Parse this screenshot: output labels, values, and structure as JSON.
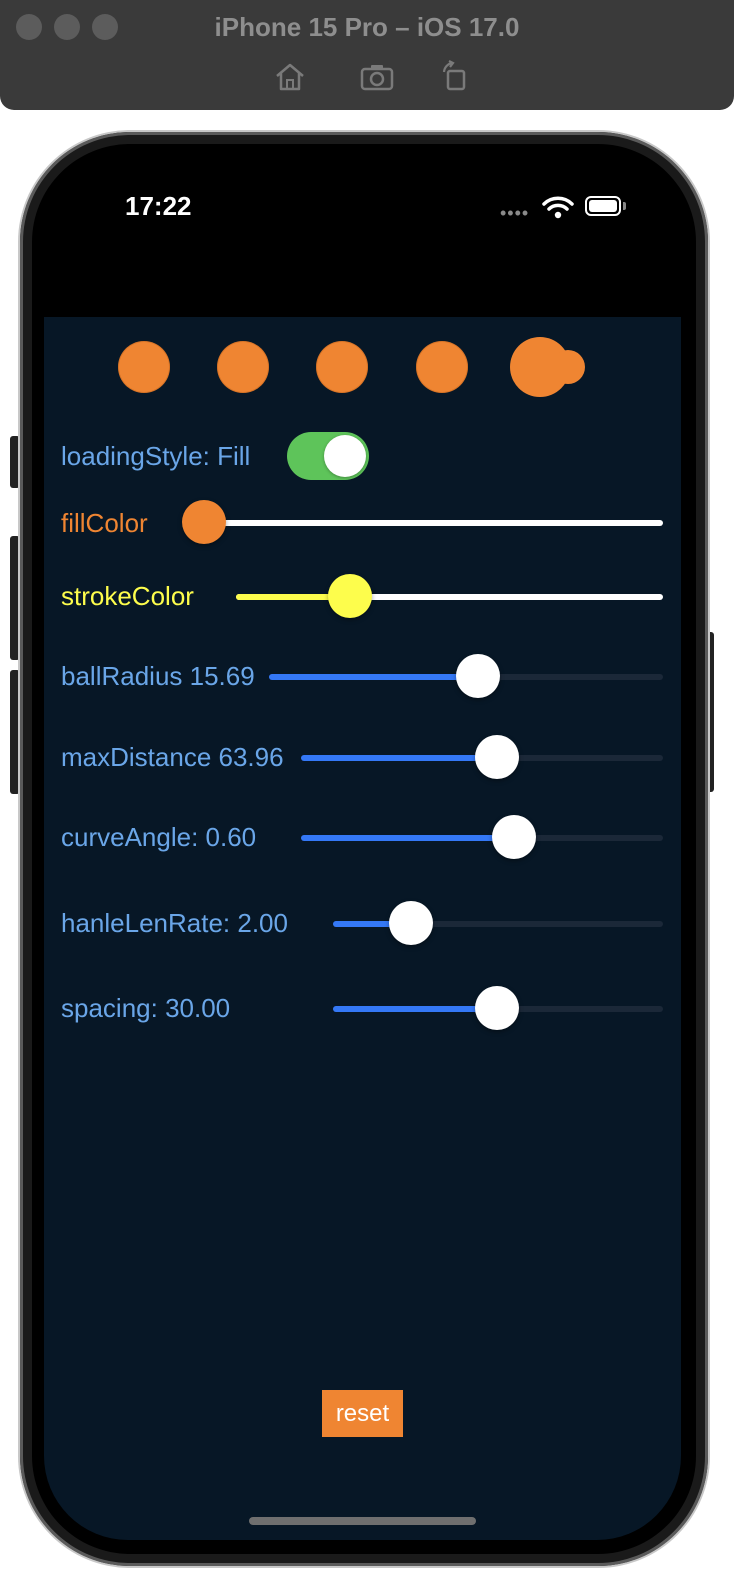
{
  "simulator": {
    "title": "iPhone 15 Pro – iOS 17.0",
    "tools": [
      "home-icon",
      "screenshot-icon",
      "rotate-icon"
    ]
  },
  "status_bar": {
    "time": "17:22",
    "signal": "••••",
    "icons": [
      "wifi-icon",
      "battery-icon"
    ]
  },
  "app": {
    "background": "#071726",
    "accent": "#ef8532",
    "balls_count": 5,
    "loading_style": {
      "label": "loadingStyle: Fill",
      "on": true
    },
    "fill_color": {
      "label": "fillColor",
      "color": "#ef8532",
      "value": 0.0
    },
    "stroke_color": {
      "label": "strokeColor",
      "color": "#fdfd4c",
      "value": 0.27
    },
    "sliders": [
      {
        "label": "ballRadius 15.69",
        "value": 0.53
      },
      {
        "label": "maxDistance 63.96",
        "value": 0.54
      },
      {
        "label": "curveAngle: 0.60",
        "value": 0.6
      },
      {
        "label": "hanleLenRate: 2.00",
        "value": 0.24
      },
      {
        "label": "spacing: 30.00",
        "value": 0.5
      }
    ],
    "reset_label": "reset"
  }
}
